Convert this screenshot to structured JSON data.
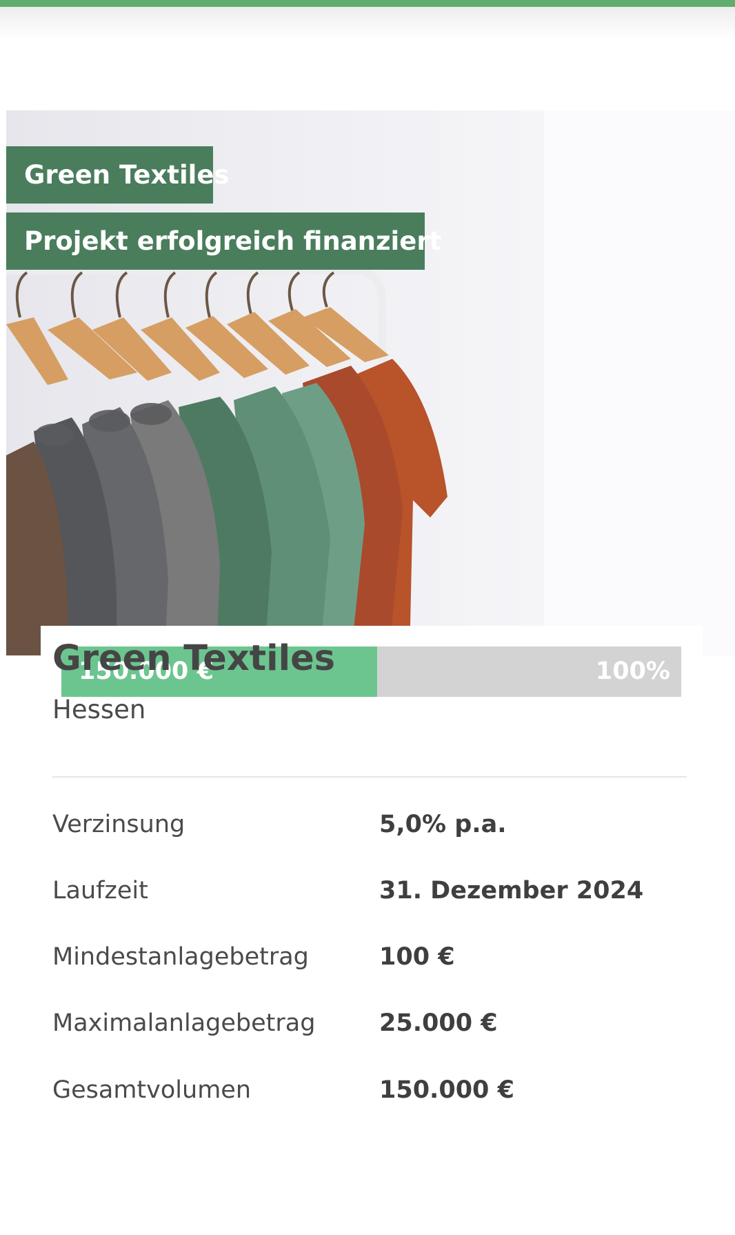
{
  "header": {
    "accent_color": "#5fae6f"
  },
  "project": {
    "tag_name": "Green Textiles",
    "tag_status": "Projekt erfolgreich finanziert",
    "title": "Green Textiles",
    "region": "Hessen",
    "hero_image": "clothes-rack-photo"
  },
  "funding": {
    "amount_label": "150.000 €",
    "percent_label": "100%",
    "progress_fraction": 0.51,
    "fill_color": "#6cc58f",
    "track_color": "#d3d3d3"
  },
  "details": [
    {
      "label": "Verzinsung",
      "value": "5,0% p.a."
    },
    {
      "label": "Laufzeit",
      "value": "31. Dezember 2024"
    },
    {
      "label": "Mindestanlagebetrag",
      "value": "100 €"
    },
    {
      "label": "Maximalanlagebetrag",
      "value": "25.000 €"
    },
    {
      "label": "Gesamtvolumen",
      "value": "150.000 €"
    }
  ]
}
